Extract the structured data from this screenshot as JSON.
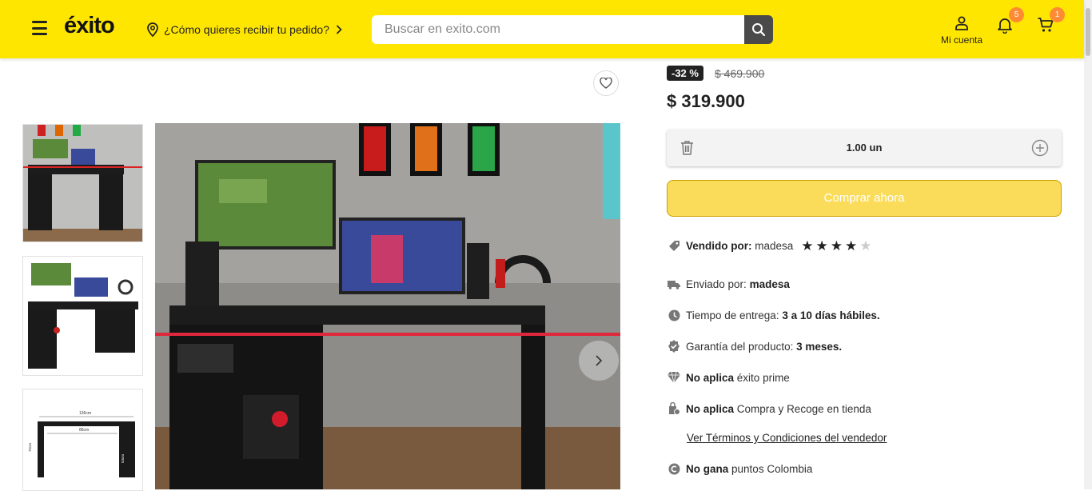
{
  "header": {
    "logo_text": "éxito",
    "location_prompt": "¿Cómo quieres recibir tu pedido?",
    "search_placeholder": "Buscar en exito.com",
    "account_label": "Mi cuenta",
    "notifications_count": "5",
    "cart_count": "1"
  },
  "product": {
    "discount": "-32 %",
    "old_price": "$ 469.900",
    "price": "$ 319.900",
    "quantity": "1.00 un",
    "buy_label": "Comprar ahora",
    "rating_stars": 4,
    "rating_max": 5
  },
  "info": {
    "sold_by_label": "Vendido por:",
    "sold_by_value": "madesa",
    "shipped_by_label": "Enviado por:",
    "shipped_by_value": "madesa",
    "delivery_label": "Tiempo de entrega:",
    "delivery_value": "3 a 10 días hábiles.",
    "warranty_label": "Garantía del producto:",
    "warranty_value": "3 meses.",
    "prime_bold": "No aplica",
    "prime_text": "éxito prime",
    "pickup_bold": "No aplica",
    "pickup_text": "Compra y Recoge en tienda",
    "terms_link": "Ver Términos y Condiciones del vendedor",
    "points_bold": "No gana",
    "points_text": "puntos Colombia"
  },
  "thumb_dims": {
    "width_label": "136cm",
    "inner_label": "86cm",
    "height_left": "75cm",
    "height_right": "53cm"
  },
  "colors": {
    "header_bg": "#ffe600",
    "buy_bg": "#fadc5a",
    "badge": "#ff8a34"
  }
}
